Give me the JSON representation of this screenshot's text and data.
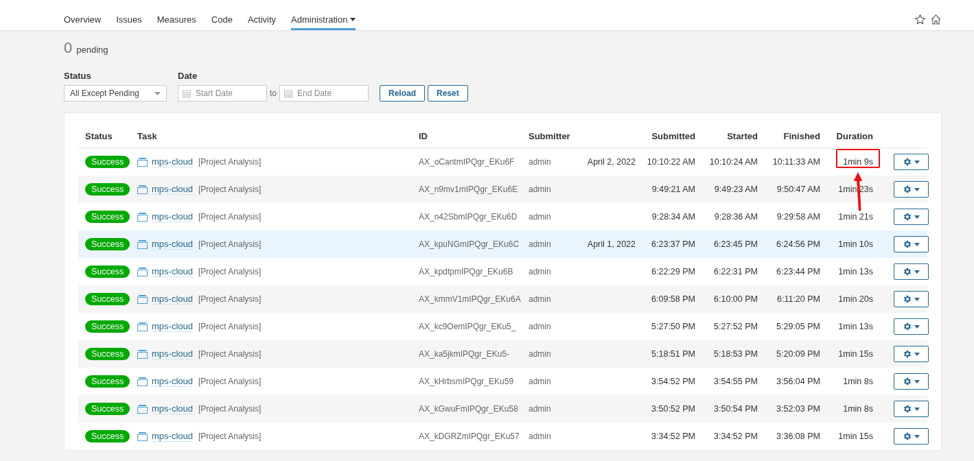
{
  "tabs": [
    {
      "label": "Overview",
      "selected": false,
      "dropdown": false
    },
    {
      "label": "Issues",
      "selected": false,
      "dropdown": false
    },
    {
      "label": "Measures",
      "selected": false,
      "dropdown": false
    },
    {
      "label": "Code",
      "selected": false,
      "dropdown": false
    },
    {
      "label": "Activity",
      "selected": false,
      "dropdown": false
    },
    {
      "label": "Administration",
      "selected": true,
      "dropdown": true
    }
  ],
  "pending": {
    "count": "0",
    "label": "pending"
  },
  "filters": {
    "status_label": "Status",
    "status_value": "All Except Pending",
    "date_label": "Date",
    "start_placeholder": "Start Date",
    "to": "to",
    "end_placeholder": "End Date",
    "buttons": [
      "Reload",
      "Reset"
    ]
  },
  "table": {
    "columns": [
      "Status",
      "Task",
      "ID",
      "Submitter",
      "Submitted",
      "Started",
      "Finished",
      "Duration"
    ],
    "rows": [
      {
        "status": "Success",
        "project": "mps-cloud",
        "type": "[Project Analysis]",
        "id": "AX_oCantmIPQgr_EKu6F",
        "submitter": "admin",
        "date": "April 2, 2022",
        "submitted": "10:10:22 AM",
        "started": "10:10:24 AM",
        "finished": "10:11:33 AM",
        "duration": "1min 9s",
        "hovered": false,
        "annotated": true
      },
      {
        "status": "Success",
        "project": "mps-cloud",
        "type": "[Project Analysis]",
        "id": "AX_n9mv1mIPQgr_EKu6E",
        "submitter": "admin",
        "submitted": "9:49:21 AM",
        "started": "9:49:23 AM",
        "finished": "9:50:47 AM",
        "duration": "1min 23s",
        "hovered": false,
        "annotated": false
      },
      {
        "status": "Success",
        "project": "mps-cloud",
        "type": "[Project Analysis]",
        "id": "AX_n42SbmIPQgr_EKu6D",
        "submitter": "admin",
        "submitted": "9:28:34 AM",
        "started": "9:28:36 AM",
        "finished": "9:29:58 AM",
        "duration": "1min 21s",
        "hovered": false,
        "annotated": false
      },
      {
        "status": "Success",
        "project": "mps-cloud",
        "type": "[Project Analysis]",
        "id": "AX_kpuNGmIPQgr_EKu6C",
        "submitter": "admin",
        "date": "April 1, 2022",
        "submitted": "6:23:37 PM",
        "started": "6:23:45 PM",
        "finished": "6:24:56 PM",
        "duration": "1min 10s",
        "hovered": true,
        "annotated": false
      },
      {
        "status": "Success",
        "project": "mps-cloud",
        "type": "[Project Analysis]",
        "id": "AX_kpdtpmIPQgr_EKu6B",
        "submitter": "admin",
        "submitted": "6:22:29 PM",
        "started": "6:22:31 PM",
        "finished": "6:23:44 PM",
        "duration": "1min 13s",
        "hovered": false,
        "annotated": false
      },
      {
        "status": "Success",
        "project": "mps-cloud",
        "type": "[Project Analysis]",
        "id": "AX_kmmV1mIPQgr_EKu6A",
        "submitter": "admin",
        "submitted": "6:09:58 PM",
        "started": "6:10:00 PM",
        "finished": "6:11:20 PM",
        "duration": "1min 20s",
        "hovered": false,
        "annotated": false
      },
      {
        "status": "Success",
        "project": "mps-cloud",
        "type": "[Project Analysis]",
        "id": "AX_kc9OemIPQgr_EKu5_",
        "submitter": "admin",
        "submitted": "5:27:50 PM",
        "started": "5:27:52 PM",
        "finished": "5:29:05 PM",
        "duration": "1min 13s",
        "hovered": false,
        "annotated": false
      },
      {
        "status": "Success",
        "project": "mps-cloud",
        "type": "[Project Analysis]",
        "id": "AX_ka5jkmIPQgr_EKu5-",
        "submitter": "admin",
        "submitted": "5:18:51 PM",
        "started": "5:18:53 PM",
        "finished": "5:20:09 PM",
        "duration": "1min 15s",
        "hovered": false,
        "annotated": false
      },
      {
        "status": "Success",
        "project": "mps-cloud",
        "type": "[Project Analysis]",
        "id": "AX_kHrbsmIPQgr_EKu59",
        "submitter": "admin",
        "submitted": "3:54:52 PM",
        "started": "3:54:55 PM",
        "finished": "3:56:04 PM",
        "duration": "1min 8s",
        "hovered": false,
        "annotated": false
      },
      {
        "status": "Success",
        "project": "mps-cloud",
        "type": "[Project Analysis]",
        "id": "AX_kGwuFmIPQgr_EKu58",
        "submitter": "admin",
        "submitted": "3:50:52 PM",
        "started": "3:50:54 PM",
        "finished": "3:52:03 PM",
        "duration": "1min 8s",
        "hovered": false,
        "annotated": false
      },
      {
        "status": "Success",
        "project": "mps-cloud",
        "type": "[Project Analysis]",
        "id": "AX_kDGRZmIPQgr_EKu57",
        "submitter": "admin",
        "submitted": "3:34:52 PM",
        "started": "3:34:52 PM",
        "finished": "3:36:08 PM",
        "duration": "1min 15s",
        "hovered": false,
        "annotated": false
      }
    ]
  }
}
